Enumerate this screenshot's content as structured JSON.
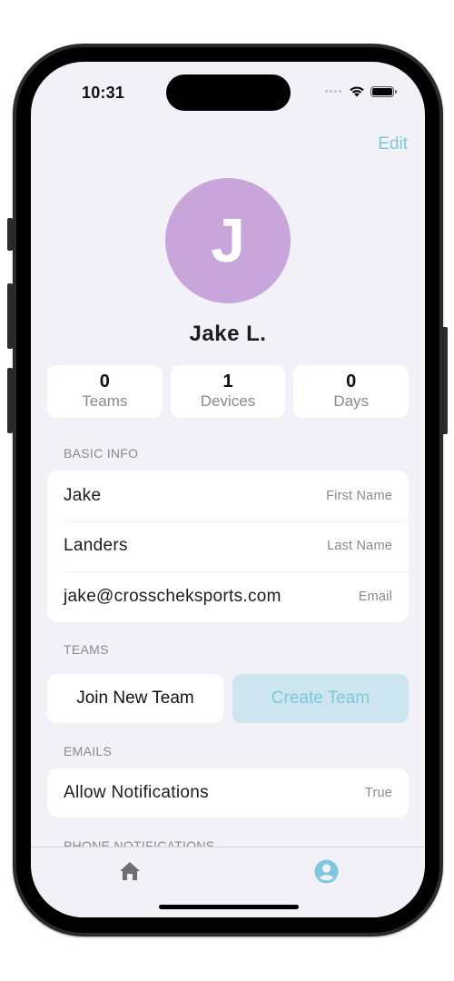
{
  "status_bar": {
    "time": "10:31",
    "icons": [
      "cellular-signal-icon",
      "wifi-icon",
      "battery-icon"
    ]
  },
  "header": {
    "edit_label": "Edit"
  },
  "profile": {
    "avatar_initial": "J",
    "avatar_color": "#C8A5DA",
    "display_name": "Jake L."
  },
  "stats": [
    {
      "value": "0",
      "label": "Teams"
    },
    {
      "value": "1",
      "label": "Devices"
    },
    {
      "value": "0",
      "label": "Days"
    }
  ],
  "basic_info": {
    "section_label": "BASIC INFO",
    "rows": [
      {
        "value": "Jake",
        "label": "First Name"
      },
      {
        "value": "Landers",
        "label": "Last Name"
      },
      {
        "value": "jake@crosscheksports.com",
        "label": "Email"
      }
    ]
  },
  "teams": {
    "section_label": "TEAMS",
    "join_label": "Join New Team",
    "create_label": "Create Team"
  },
  "emails": {
    "section_label": "EMAILS",
    "rows": [
      {
        "value": "Allow Notifications",
        "label": "True"
      }
    ]
  },
  "phone_notifications": {
    "section_label": "PHONE NOTIFICATIONS"
  },
  "tab_bar": {
    "tabs": [
      {
        "name": "home",
        "icon": "home-icon",
        "active": false
      },
      {
        "name": "profile",
        "icon": "person-circle-icon",
        "active": true
      }
    ],
    "active_color": "#7EC8DC",
    "inactive_color": "#6E6E6E"
  },
  "colors": {
    "accent": "#7EC8DC",
    "accent_light": "#CDE5EF",
    "background": "#F2F1F7"
  }
}
